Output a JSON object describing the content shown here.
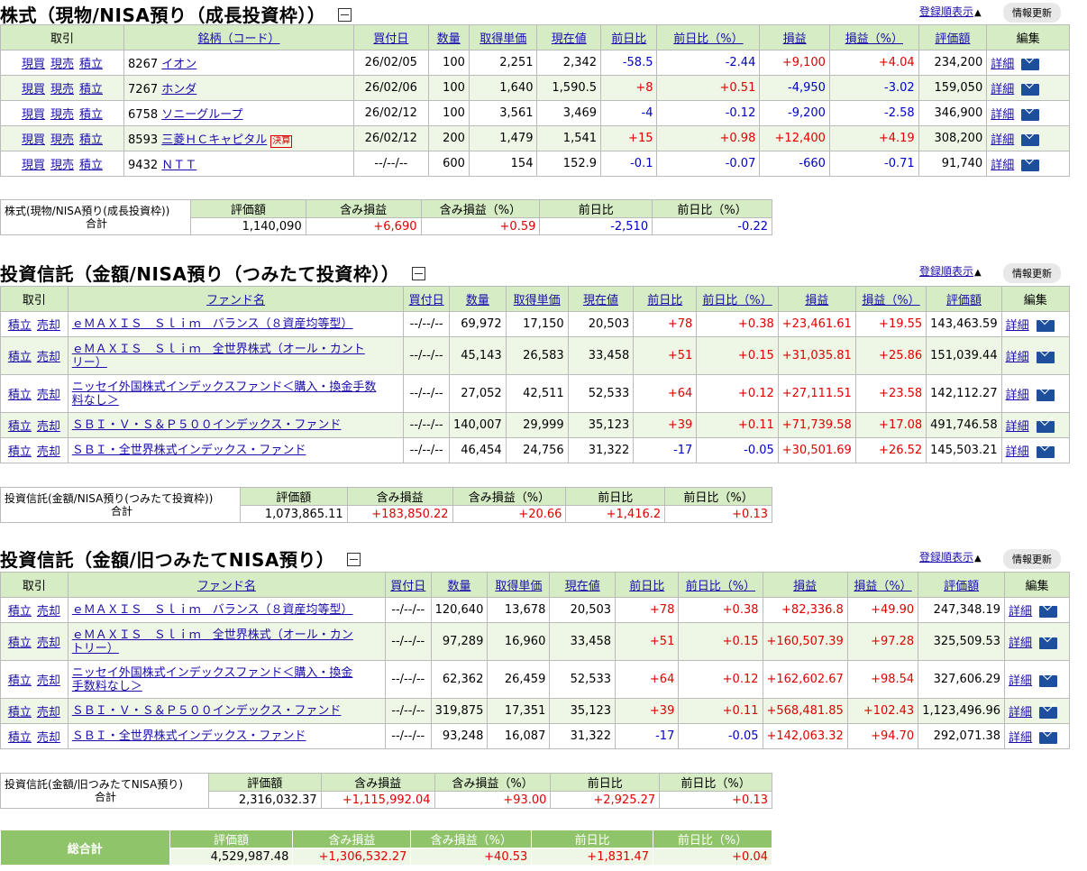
{
  "common": {
    "sort_link": "登録順表示",
    "update_button": "情報更新",
    "actions_stock": [
      "現買",
      "現売",
      "積立"
    ],
    "actions_fund": [
      "積立",
      "売却"
    ],
    "detail": "詳細"
  },
  "stocks": {
    "title": "株式（現物/NISA預り（成長投資枠））",
    "headers": [
      "取引",
      "銘柄（コード）",
      "買付日",
      "数量",
      "取得単価",
      "現在値",
      "前日比",
      "前日比（%）",
      "損益",
      "損益（%）",
      "評価額",
      "編集"
    ],
    "rows": [
      {
        "code": "8267",
        "name": "イオン",
        "badge": "",
        "date": "26/02/05",
        "qty": "100",
        "cost": "2,251",
        "price": "2,342",
        "chg": "-58.5",
        "chgp": "-2.44",
        "pl": "+9,100",
        "plp": "+4.04",
        "value": "234,200"
      },
      {
        "code": "7267",
        "name": "ホンダ",
        "badge": "",
        "date": "26/02/06",
        "qty": "100",
        "cost": "1,640",
        "price": "1,590.5",
        "chg": "+8",
        "chgp": "+0.51",
        "pl": "-4,950",
        "plp": "-3.02",
        "value": "159,050"
      },
      {
        "code": "6758",
        "name": "ソニーグループ",
        "badge": "",
        "date": "26/02/12",
        "qty": "100",
        "cost": "3,561",
        "price": "3,469",
        "chg": "-4",
        "chgp": "-0.12",
        "pl": "-9,200",
        "plp": "-2.58",
        "value": "346,900"
      },
      {
        "code": "8593",
        "name": "三菱ＨＣキャピタル",
        "badge": "決算",
        "date": "26/02/12",
        "qty": "200",
        "cost": "1,479",
        "price": "1,541",
        "chg": "+15",
        "chgp": "+0.98",
        "pl": "+12,400",
        "plp": "+4.19",
        "value": "308,200"
      },
      {
        "code": "9432",
        "name": "ＮＴＴ",
        "badge": "",
        "date": "--/--/--",
        "qty": "600",
        "cost": "154",
        "price": "152.9",
        "chg": "-0.1",
        "chgp": "-0.07",
        "pl": "-660",
        "plp": "-0.71",
        "value": "91,740"
      }
    ],
    "summary": {
      "label1": "株式(現物/NISA預り(成長投資枠))",
      "label2": "合計",
      "headers": [
        "評価額",
        "含み損益",
        "含み損益（%）",
        "前日比",
        "前日比（%）"
      ],
      "values": [
        "1,140,090",
        "+6,690",
        "+0.59",
        "-2,510",
        "-0.22"
      ]
    }
  },
  "fund1": {
    "title": "投資信託（金額/NISA預り（つみたて投資枠））",
    "headers": [
      "取引",
      "ファンド名",
      "買付日",
      "数量",
      "取得単価",
      "現在値",
      "前日比",
      "前日比（%）",
      "損益",
      "損益（%）",
      "評価額",
      "編集"
    ],
    "rows": [
      {
        "name": [
          "ｅＭＡＸＩＳ　Ｓｌｉｍ　バランス（８資産均等型）"
        ],
        "date": "--/--/--",
        "qty": "69,972",
        "cost": "17,150",
        "price": "20,503",
        "chg": "+78",
        "chgp": "+0.38",
        "pl": "+23,461.61",
        "plp": "+19.55",
        "value": "143,463.59"
      },
      {
        "name": [
          "ｅＭＡＸＩＳ　Ｓｌｉｍ　全世界株式（オール・カント",
          "リー）"
        ],
        "date": "--/--/--",
        "qty": "45,143",
        "cost": "26,583",
        "price": "33,458",
        "chg": "+51",
        "chgp": "+0.15",
        "pl": "+31,035.81",
        "plp": "+25.86",
        "value": "151,039.44"
      },
      {
        "name": [
          "ニッセイ外国株式インデックスファンド＜購入・換金手数",
          "料なし＞"
        ],
        "date": "--/--/--",
        "qty": "27,052",
        "cost": "42,511",
        "price": "52,533",
        "chg": "+64",
        "chgp": "+0.12",
        "pl": "+27,111.51",
        "plp": "+23.58",
        "value": "142,112.27"
      },
      {
        "name": [
          "ＳＢＩ・Ｖ・Ｓ＆Ｐ５００インデックス・ファンド"
        ],
        "date": "--/--/--",
        "qty": "140,007",
        "cost": "29,999",
        "price": "35,123",
        "chg": "+39",
        "chgp": "+0.11",
        "pl": "+71,739.58",
        "plp": "+17.08",
        "value": "491,746.58"
      },
      {
        "name": [
          "ＳＢＩ・全世界株式インデックス・ファンド"
        ],
        "date": "--/--/--",
        "qty": "46,454",
        "cost": "24,756",
        "price": "31,322",
        "chg": "-17",
        "chgp": "-0.05",
        "pl": "+30,501.69",
        "plp": "+26.52",
        "value": "145,503.21"
      }
    ],
    "summary": {
      "label1": "投資信託(金額/NISA預り(つみたて投資枠))",
      "label2": "合計",
      "headers": [
        "評価額",
        "含み損益",
        "含み損益（%）",
        "前日比",
        "前日比（%）"
      ],
      "values": [
        "1,073,865.11",
        "+183,850.22",
        "+20.66",
        "+1,416.2",
        "+0.13"
      ]
    }
  },
  "fund2": {
    "title": "投資信託（金額/旧つみたてNISA預り）",
    "headers": [
      "取引",
      "ファンド名",
      "買付日",
      "数量",
      "取得単価",
      "現在値",
      "前日比",
      "前日比（%）",
      "損益",
      "損益（%）",
      "評価額",
      "編集"
    ],
    "rows": [
      {
        "name": [
          "ｅＭＡＸＩＳ　Ｓｌｉｍ　バランス（８資産均等型）"
        ],
        "date": "--/--/--",
        "qty": "120,640",
        "cost": "13,678",
        "price": "20,503",
        "chg": "+78",
        "chgp": "+0.38",
        "pl": "+82,336.8",
        "plp": "+49.90",
        "value": "247,348.19"
      },
      {
        "name": [
          "ｅＭＡＸＩＳ　Ｓｌｉｍ　全世界株式（オール・カン",
          "トリー）"
        ],
        "date": "--/--/--",
        "qty": "97,289",
        "cost": "16,960",
        "price": "33,458",
        "chg": "+51",
        "chgp": "+0.15",
        "pl": "+160,507.39",
        "plp": "+97.28",
        "value": "325,509.53"
      },
      {
        "name": [
          "ニッセイ外国株式インデックスファンド＜購入・換金",
          "手数料なし＞"
        ],
        "date": "--/--/--",
        "qty": "62,362",
        "cost": "26,459",
        "price": "52,533",
        "chg": "+64",
        "chgp": "+0.12",
        "pl": "+162,602.67",
        "plp": "+98.54",
        "value": "327,606.29"
      },
      {
        "name": [
          "ＳＢＩ・Ｖ・Ｓ＆Ｐ５００インデックス・ファンド"
        ],
        "date": "--/--/--",
        "qty": "319,875",
        "cost": "17,351",
        "price": "35,123",
        "chg": "+39",
        "chgp": "+0.11",
        "pl": "+568,481.85",
        "plp": "+102.43",
        "value": "1,123,496.96"
      },
      {
        "name": [
          "ＳＢＩ・全世界株式インデックス・ファンド"
        ],
        "date": "--/--/--",
        "qty": "93,248",
        "cost": "16,087",
        "price": "31,322",
        "chg": "-17",
        "chgp": "-0.05",
        "pl": "+142,063.32",
        "plp": "+94.70",
        "value": "292,071.38"
      }
    ],
    "summary": {
      "label1": "投資信託(金額/旧つみたてNISA預り)",
      "label2": "合計",
      "headers": [
        "評価額",
        "含み損益",
        "含み損益（%）",
        "前日比",
        "前日比（%）"
      ],
      "values": [
        "2,316,032.37",
        "+1,115,992.04",
        "+93.00",
        "+2,925.27",
        "+0.13"
      ]
    }
  },
  "grand_total": {
    "label": "総合計",
    "headers": [
      "評価額",
      "含み損益",
      "含み損益（%）",
      "前日比",
      "前日比（%）"
    ],
    "values": [
      "4,529,987.48",
      "+1,306,532.27",
      "+40.53",
      "+1,831.47",
      "+0.04"
    ]
  }
}
